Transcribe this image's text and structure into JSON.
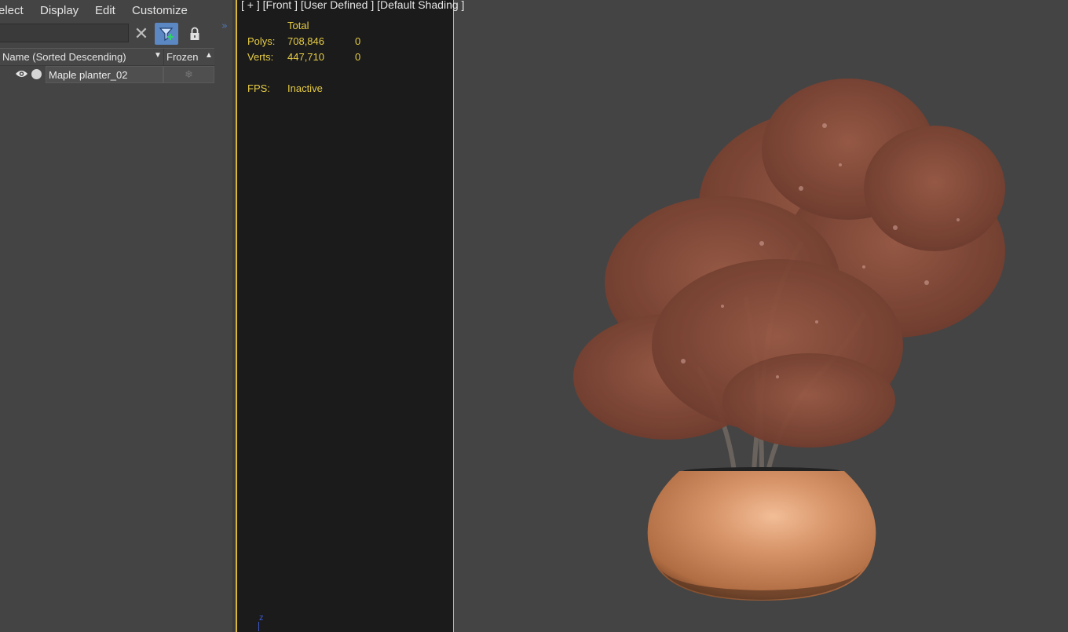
{
  "menu": [
    "elect",
    "Display",
    "Edit",
    "Customize"
  ],
  "explorer": {
    "search": {
      "value": "",
      "placeholder": ""
    },
    "columns": {
      "name": "Name (Sorted Descending)",
      "frozen": "Frozen"
    },
    "rows": [
      {
        "name": "Maple planter_02",
        "visible": true,
        "frozen": false
      }
    ]
  },
  "viewport": {
    "label": "[ + ] [Front ] [User Defined ] [Default Shading ]",
    "stats": {
      "total_header": "Total",
      "polys_label": "Polys:",
      "polys_total": "708,846",
      "polys_selected": "0",
      "verts_label": "Verts:",
      "verts_total": "447,710",
      "verts_selected": "0",
      "fps_label": "FPS:",
      "fps_value": "Inactive"
    },
    "axis_label": "z"
  },
  "colors": {
    "panel_bg": "#444444",
    "stats_bg": "#1b1b1b",
    "stats_text": "#e6cc45",
    "viewport_border": "#d9b53c",
    "filter_active": "#5b87c2",
    "foliage": "#8a4a36",
    "pot": "#cd8a5a"
  },
  "icons": [
    "close-icon",
    "filter-icon",
    "lock-icon",
    "expand-icon",
    "eye-icon",
    "light-dot-icon",
    "snowflake-icon"
  ]
}
